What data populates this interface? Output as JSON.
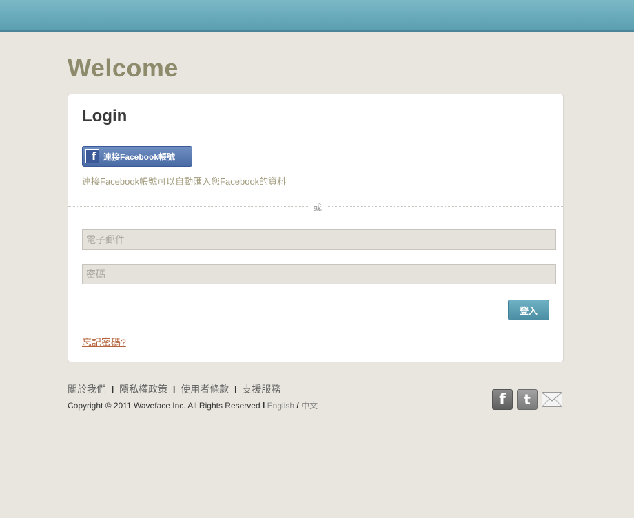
{
  "header": {
    "welcome": "Welcome"
  },
  "login": {
    "title": "Login",
    "facebook_button_label": "連接Facebook帳號",
    "facebook_description": "連接Facebook帳號可以自動匯入您Facebook的資料",
    "or_text": "或",
    "email_placeholder": "電子郵件",
    "password_placeholder": "密碼",
    "submit_label": "登入",
    "forgot_password": "忘記密碼?"
  },
  "footer": {
    "links": [
      "關於我們",
      "隱私權政策",
      "使用者條款",
      "支援服務"
    ],
    "link_separator": "l",
    "copyright": "Copyright © 2011 Waveface Inc. All Rights Reserved",
    "copyright_separator": "l",
    "languages": [
      "English",
      "中文"
    ],
    "language_separator": "/"
  },
  "social": {
    "icons": [
      "facebook-icon",
      "twitter-icon",
      "mail-icon"
    ]
  },
  "colors": {
    "top_bar": "#6aaabb",
    "welcome_text": "#8e8a6c",
    "facebook_button": "#4a6aa5",
    "submit_button": "#4b8ea3",
    "forgot_link": "#b5643c",
    "background": "#e9e6df"
  }
}
